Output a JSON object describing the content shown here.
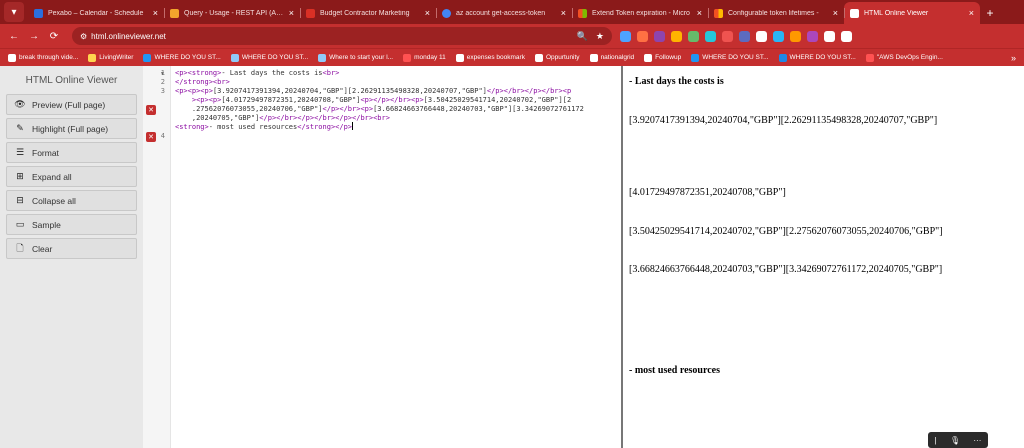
{
  "browser": {
    "tabs": [
      {
        "label": "Pexabo – Calendar - Schedule",
        "color": "#2b6fde"
      },
      {
        "label": "Query - Usage - REST API (Azure",
        "color": "#f2a52c"
      },
      {
        "label": "Budget Contractor Marketing",
        "color": "#d93025"
      },
      {
        "label": "az account get-access-token",
        "color": "#4285f4"
      },
      {
        "label": "Extend Token expiration - Micro",
        "color": "#f25022"
      },
      {
        "label": "Configurable token lifetimes -",
        "color": "#f25022"
      },
      {
        "label": "HTML Online Viewer",
        "color": "#ffffff",
        "active": true
      }
    ],
    "close_glyph": "×",
    "new_tab_glyph": "+",
    "dropdown_glyph": "▾",
    "url": "html.onlineviewer.net",
    "nav": {
      "back": "←",
      "forward": "→",
      "reload": "⟳",
      "site_info": "⚙"
    },
    "omnibox_icons": [
      "🔍",
      "★"
    ],
    "extensions": [
      "#4ea3ff",
      "#ff7043",
      "#8e44ad",
      "#ffb300",
      "#66bb6a",
      "#26c6da",
      "#ef5350",
      "#5c6bc0",
      "#ffffff",
      "#29b6f6",
      "#ff9800",
      "#ab47bc",
      "#ffffff",
      "#ffffff"
    ],
    "bookmarks": [
      {
        "label": "break through vide...",
        "color": "#ffffff"
      },
      {
        "label": "LivingWriter",
        "color": "#ffd54f"
      },
      {
        "label": "WHERE DO YOU ST...",
        "color": "#2196f3"
      },
      {
        "label": "WHERE DO YOU ST...",
        "color": "#90caf9"
      },
      {
        "label": "Where to start your l...",
        "color": "#90caf9"
      },
      {
        "label": "monday 11",
        "color": "#ff5252"
      },
      {
        "label": "expenses bookmark",
        "color": "#ffffff"
      },
      {
        "label": "Oppurtunity",
        "color": "#ffffff"
      },
      {
        "label": "nationalgrid",
        "color": "#ffffff"
      },
      {
        "label": "Followup",
        "color": "#ffffff"
      },
      {
        "label": "WHERE DO YOU ST...",
        "color": "#2196f3"
      },
      {
        "label": "WHERE DO YOU ST...",
        "color": "#1e88e5"
      },
      {
        "label": "\"AWS DevOps Engin...",
        "color": "#ff5252"
      }
    ],
    "bookmarks_more": "»"
  },
  "app": {
    "title": "HTML Online Viewer",
    "buttons": [
      {
        "label": "Preview (Full page)",
        "icon": "eye-icon",
        "glyph": "👁"
      },
      {
        "label": "Highlight (Full page)",
        "icon": "edit-icon",
        "glyph": "✎"
      },
      {
        "label": "Format",
        "icon": "format-icon",
        "glyph": "☰"
      },
      {
        "label": "Expand all",
        "icon": "plus-icon",
        "glyph": "⊞"
      },
      {
        "label": "Collapse all",
        "icon": "minus-icon",
        "glyph": "⊟"
      },
      {
        "label": "Sample",
        "icon": "sample-icon",
        "glyph": "▭"
      },
      {
        "label": "Clear",
        "icon": "file-icon",
        "glyph": "🗋"
      }
    ]
  },
  "editor": {
    "line_numbers": [
      "1",
      "2",
      "3",
      "4"
    ],
    "error_glyph": "✕",
    "fold_glyph": "▼",
    "lines": [
      [
        {
          "t": "tag",
          "v": "<p><strong>"
        },
        {
          "t": "txt",
          "v": "- Last days the costs is"
        },
        {
          "t": "tag",
          "v": "<br>"
        }
      ],
      [
        {
          "t": "tag",
          "v": "</strong><br>"
        }
      ],
      [
        {
          "t": "tag",
          "v": "<p><p><p>"
        },
        {
          "t": "txt",
          "v": "[3.9207417391394,20240704,\"GBP\"][2.26291135498328,20240707,\"GBP\"]"
        },
        {
          "t": "tag",
          "v": "</p></br></p></br><p"
        }
      ],
      [
        {
          "t": "tag",
          "v": "    ><p><p>"
        },
        {
          "t": "txt",
          "v": "[4.01729497872351,20240708,\"GBP\"]"
        },
        {
          "t": "tag",
          "v": "<p></p></br><p>"
        },
        {
          "t": "txt",
          "v": "[3.50425029541714,20240702,\"GBP\"][2"
        }
      ],
      [
        {
          "t": "txt",
          "v": "    .27562076073055,20240706,\"GBP\"]"
        },
        {
          "t": "tag",
          "v": "</p></br><p>"
        },
        {
          "t": "txt",
          "v": "[3.66824663766448,20240703,\"GBP\"][3.34269072761172"
        }
      ],
      [
        {
          "t": "txt",
          "v": "    ,20240705,\"GBP\"]"
        },
        {
          "t": "tag",
          "v": "</p></br></p></br></p></br><br>"
        }
      ],
      [
        {
          "t": "tag",
          "v": "<strong>"
        },
        {
          "t": "txt",
          "v": "- most used resources"
        },
        {
          "t": "tag",
          "v": "</strong></p>"
        }
      ]
    ]
  },
  "preview": {
    "heading1": "- Last days the costs is",
    "rows": [
      "[3.9207417391394,20240704,\"GBP\"][2.26291135498328,20240707,\"GBP\"]",
      "[4.01729497872351,20240708,\"GBP\"]",
      "[3.50425029541714,20240702,\"GBP\"][2.27562076073055,20240706,\"GBP\"]",
      "[3.66824663766448,20240703,\"GBP\"][3.34269072761172,20240705,\"GBP\"]"
    ],
    "heading2": "- most used resources"
  },
  "mini_toolbar": [
    "|",
    "🎙",
    "···"
  ]
}
